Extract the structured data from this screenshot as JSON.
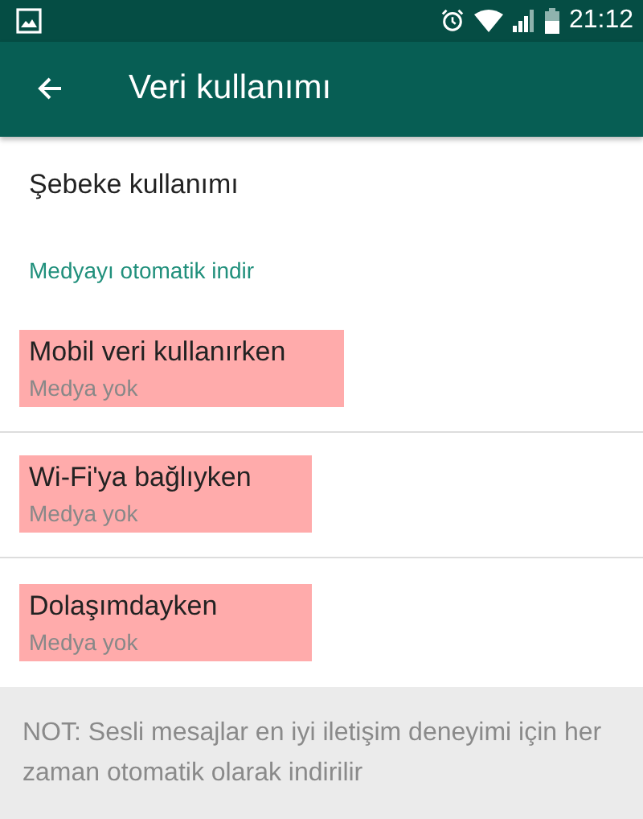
{
  "status_bar": {
    "time": "21:12"
  },
  "toolbar": {
    "title": "Veri kullanımı"
  },
  "network_usage": {
    "label": "Şebeke kullanımı"
  },
  "section": {
    "title": "Medyayı otomatik indir"
  },
  "items": [
    {
      "title": "Mobil veri kullanırken",
      "subtitle": "Medya yok",
      "highlighted": true
    },
    {
      "title": "Wi-Fi'ya bağlıyken",
      "subtitle": "Medya yok",
      "highlighted": true
    },
    {
      "title": "Dolaşımdayken",
      "subtitle": "Medya yok",
      "highlighted": true
    }
  ],
  "note": "NOT: Sesli mesajlar en iyi iletişim deneyimi için her zaman otomatik olarak indirilir"
}
